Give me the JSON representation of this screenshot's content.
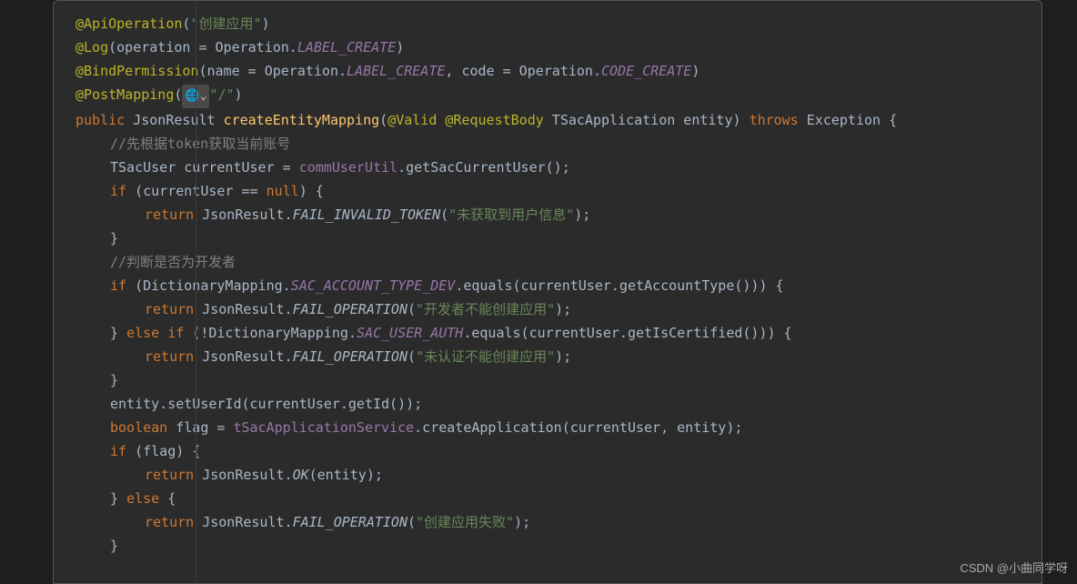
{
  "watermark": "CSDN @小曲同学呀",
  "postmapping_hint": "\"/\"",
  "code": {
    "l1": {
      "anno": "@ApiOperation",
      "open": "(",
      "s": "\"创建应用\"",
      "close": ")"
    },
    "l2": {
      "anno": "@Log",
      "open": "(operation = Operation.",
      "field": "LABEL_CREATE",
      "close": ")"
    },
    "l3": {
      "anno": "@BindPermission",
      "open": "(name = Operation.",
      "f1": "LABEL_CREATE",
      "mid": ", code = Operation.",
      "f2": "CODE_CREATE",
      "close": ")"
    },
    "l4": {
      "anno": "@PostMapping",
      "open": "(",
      "close": ")"
    },
    "l5": {
      "k1": "public",
      "t": " JsonResult ",
      "m": "createEntityMapping",
      "p1": "(",
      "at1": "@Valid",
      "sp1": " ",
      "at2": "@RequestBody",
      "p2": " TSacApplication entity) ",
      "k2": "throws",
      "p3": " Exception {"
    },
    "l6": {
      "c": "//先根据token获取当前账号"
    },
    "l7": {
      "a": "TSacUser currentUser = ",
      "mem": "commUserUtil",
      "b": ".getSacCurrentUser();"
    },
    "l8": {
      "k": "if",
      "a": " (currentUser == ",
      "k2": "null",
      "b": ") {"
    },
    "l9": {
      "k": "return",
      "a": " JsonResult.",
      "sm": "FAIL_INVALID_TOKEN",
      "b": "(",
      "s": "\"未获取到用户信息\"",
      "c": ");"
    },
    "l10": {
      "a": "}"
    },
    "l11": {
      "c": "//判断是否为开发者"
    },
    "l12": {
      "k": "if",
      "a": " (DictionaryMapping.",
      "sf": "SAC_ACCOUNT_TYPE_DEV",
      "b": ".equals(currentUser.getAccountType())) {"
    },
    "l13": {
      "k": "return",
      "a": " JsonResult.",
      "sm": "FAIL_OPERATION",
      "b": "(",
      "s": "\"开发者不能创建应用\"",
      "c": ");"
    },
    "l14": {
      "a": "} ",
      "k": "else if",
      "b": " (!DictionaryMapping.",
      "sf": "SAC_USER_AUTH",
      "c": ".equals(currentUser.getIsCertified())) {"
    },
    "l15": {
      "k": "return",
      "a": " JsonResult.",
      "sm": "FAIL_OPERATION",
      "b": "(",
      "s": "\"未认证不能创建应用\"",
      "c": ");"
    },
    "l16": {
      "a": "}"
    },
    "l17": {
      "a": "entity.setUserId(currentUser.getId());"
    },
    "l18": {
      "k": "boolean",
      "a": " flag = ",
      "mem": "tSacApplicationService",
      "b": ".createApplication(currentUser, entity);"
    },
    "l19": {
      "k": "if",
      "a": " (flag) {"
    },
    "l20": {
      "k": "return",
      "a": " JsonResult.",
      "sm": "OK",
      "b": "(entity);"
    },
    "l21": {
      "a": "} ",
      "k": "else",
      "b": " {"
    },
    "l22": {
      "k": "return",
      "a": " JsonResult.",
      "sm": "FAIL_OPERATION",
      "b": "(",
      "s": "\"创建应用失败\"",
      "c": ");"
    },
    "l23": {
      "a": "}"
    }
  }
}
